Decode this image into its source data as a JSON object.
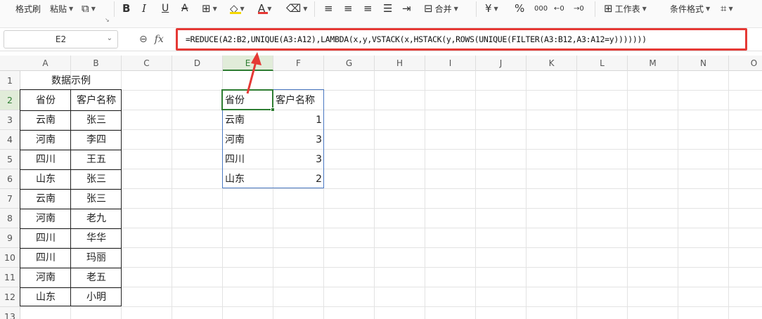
{
  "ribbon": {
    "format_painter": "格式刷",
    "paste": "粘贴",
    "merge": "合并",
    "worksheet": "工作表",
    "conditional_format": "条件格式",
    "icons": [
      "copy-icon",
      "bold-icon",
      "italic-icon",
      "underline-icon",
      "strikethrough-icon",
      "borders-icon",
      "fill-color-icon",
      "font-color-icon",
      "clear-format-icon",
      "align-left-icon",
      "align-center-icon",
      "align-right-icon",
      "justify-icon",
      "wrap-text-icon",
      "merge-icon",
      "currency-icon",
      "percent-icon",
      "thousands-icon",
      "decrease-decimal-icon",
      "increase-decimal-icon",
      "worksheet-icon",
      "cell-borders-icon"
    ],
    "fill_color": "#f5d800",
    "font_color": "#e53935"
  },
  "formula_bar": {
    "name_box": "E2",
    "fx_label": "fx",
    "formula": "=REDUCE(A2:B2,UNIQUE(A3:A12),LAMBDA(x,y,VSTACK(x,HSTACK(y,ROWS(UNIQUE(FILTER(A3:B12,A3:A12=y)))))))"
  },
  "columns": [
    "A",
    "B",
    "C",
    "D",
    "E",
    "F",
    "G",
    "H",
    "I",
    "J",
    "K",
    "L",
    "M",
    "N",
    "O"
  ],
  "rows": [
    "1",
    "2",
    "3",
    "4",
    "5",
    "6",
    "7",
    "8",
    "9",
    "10",
    "11",
    "12",
    "13"
  ],
  "active_cell": "E2",
  "table_a": {
    "title": "数据示例",
    "headers": [
      "省份",
      "客户名称"
    ],
    "rows": [
      [
        "云南",
        "张三"
      ],
      [
        "河南",
        "李四"
      ],
      [
        "四川",
        "王五"
      ],
      [
        "山东",
        "张三"
      ],
      [
        "云南",
        "张三"
      ],
      [
        "河南",
        "老九"
      ],
      [
        "四川",
        "华华"
      ],
      [
        "四川",
        "玛丽"
      ],
      [
        "河南",
        "老五"
      ],
      [
        "山东",
        "小明"
      ]
    ]
  },
  "table_e": {
    "headers": [
      "省份",
      "客户名称"
    ],
    "rows": [
      [
        "云南",
        "1"
      ],
      [
        "河南",
        "3"
      ],
      [
        "四川",
        "3"
      ],
      [
        "山东",
        "2"
      ]
    ]
  },
  "annotation": {
    "color": "#e53935"
  }
}
